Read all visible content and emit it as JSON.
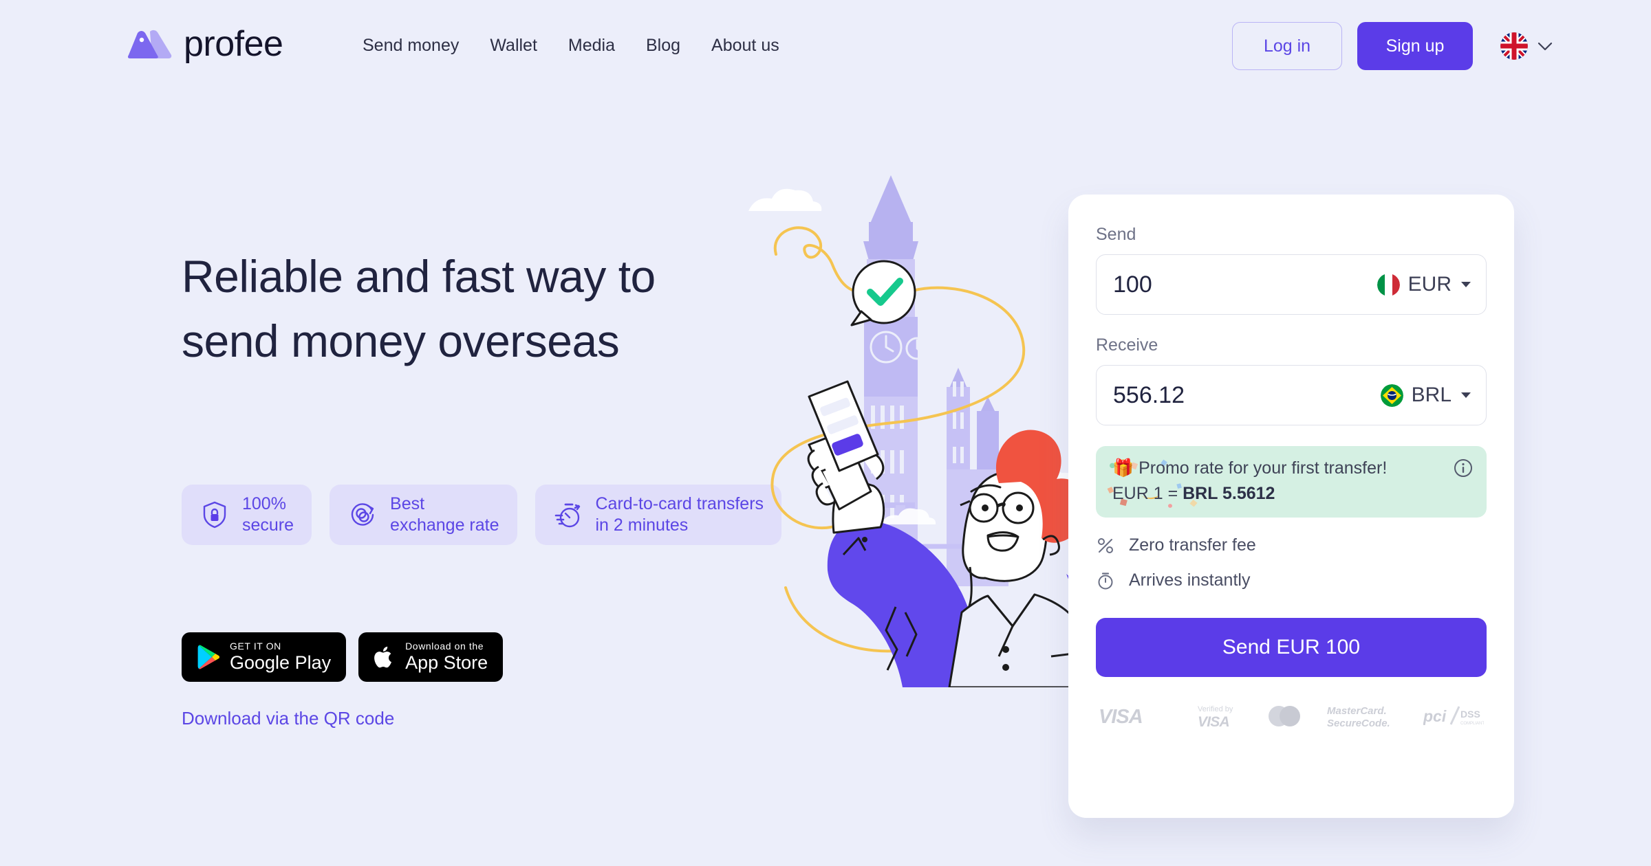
{
  "brand": {
    "name": "profee",
    "accent": "#5b3ce8",
    "accent_light": "#5b46e5",
    "page_bg": "#eceefa"
  },
  "header": {
    "logo_text": "profee",
    "nav": [
      {
        "label": "Send money"
      },
      {
        "label": "Wallet"
      },
      {
        "label": "Media"
      },
      {
        "label": "Blog"
      },
      {
        "label": "About us"
      }
    ],
    "login_label": "Log in",
    "signup_label": "Sign up",
    "language": {
      "flag": "uk-flag-icon",
      "chevron": "chevron-down-icon"
    }
  },
  "hero": {
    "title": "Reliable and fast way to send money overseas",
    "badges": [
      {
        "icon": "shield-lock-icon",
        "text": "100%\nsecure"
      },
      {
        "icon": "exchange-rate-icon",
        "text": "Best\nexchange rate"
      },
      {
        "icon": "stopwatch-icon",
        "text": "Card-to-card transfers\nin 2 minutes"
      }
    ],
    "stores": [
      {
        "icon": "google-play-icon",
        "small": "GET IT ON",
        "big": "Google Play"
      },
      {
        "icon": "apple-icon",
        "small": "Download on the",
        "big": "App Store"
      }
    ],
    "qr_link": "Download via the QR code"
  },
  "calculator": {
    "send_label": "Send",
    "send_amount": "100",
    "send_placeholder": "0",
    "send_currency": "EUR",
    "send_flag": "italy-flag-icon",
    "receive_label": "Receive",
    "receive_amount": "556.12",
    "receive_placeholder": "0",
    "receive_currency": "BRL",
    "receive_flag": "brazil-flag-icon",
    "promo": {
      "headline": "🎁 Promo rate for your first transfer!",
      "rate_prefix": "EUR 1 = ",
      "rate_value": "BRL 5.5612",
      "info_icon": "info-circle-icon",
      "bg": "#d5f0e3"
    },
    "info_rows": [
      {
        "icon": "percent-icon",
        "text": "Zero transfer fee"
      },
      {
        "icon": "stopwatch-icon",
        "text": "Arrives instantly"
      }
    ],
    "submit_label": "Send EUR 100",
    "payment_logos": [
      {
        "name": "visa-logo"
      },
      {
        "name": "verified-by-visa-logo"
      },
      {
        "name": "mastercard-logo"
      },
      {
        "name": "mastercard-securecode-logo"
      },
      {
        "name": "pci-dss-logo"
      }
    ]
  }
}
